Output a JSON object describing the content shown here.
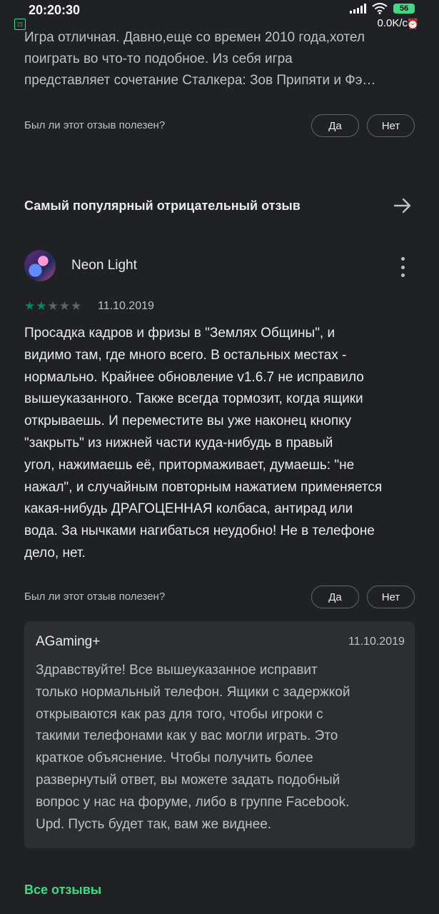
{
  "status": {
    "time": "20:20:30",
    "battery": "56",
    "speed": "0.0K/c"
  },
  "prev_review": {
    "lines": [
      "Игра отличная. Давно,еще со времен 2010 года,хотел",
      "поиграть во что-то подобное. Из себя игра",
      "представляет сочетание Сталкера: Зов Припяти и Фэ…"
    ],
    "helpful_question": "Был ли этот отзыв полезен?",
    "yes_label": "Да",
    "no_label": "Нет"
  },
  "section": {
    "title": "Самый популярный отрицательный отзыв"
  },
  "review": {
    "author": "Neon Light",
    "rating": 2,
    "max_rating": 5,
    "date": "11.10.2019",
    "lines": [
      "Просадка кадров и фризы в \"Землях Общины\", и",
      "видимо там, где много всего. В остальных местах -",
      "нормально. Крайнее обновление v1.6.7 не исправило",
      "вышеуказанного. Также всегда тормозит, когда ящики",
      "открываешь. И переместите вы уже наконец кнопку",
      "\"закрыть\" из нижней части куда-нибудь в правый",
      "угол, нажимаешь её, притормаживает, думаешь: \"не",
      "нажал\", и случайным повторным нажатием применяется",
      "какая-нибудь ДРАГОЦЕННАЯ колбаса, антирад или",
      "вода. За нычками нагибаться неудобно! Не в телефоне",
      "дело, нет."
    ],
    "helpful_question": "Был ли этот отзыв полезен?",
    "yes_label": "Да",
    "no_label": "Нет"
  },
  "reply": {
    "developer": "AGaming+",
    "date": "11.10.2019",
    "lines": [
      "Здравствуйте! Все вышеуказанное исправит",
      "только нормальный телефон. Ящики с задержкой",
      "открываются как раз для того, чтобы игроки с",
      "такими телефонами как у вас могли играть. Это",
      "краткое объяснение. Чтобы получить более",
      "развернутый ответ, вы можете задать подобный",
      "вопрос у нас на форуме, либо в группе Facebook.",
      "Upd. Пусть будет так, вам же виднее."
    ]
  },
  "footer": {
    "all_reviews_label": "Все отзывы"
  },
  "colors": {
    "background": "#202124",
    "accent": "#01875f",
    "link": "#3ddc84",
    "reply_bg": "#2d2e31"
  }
}
